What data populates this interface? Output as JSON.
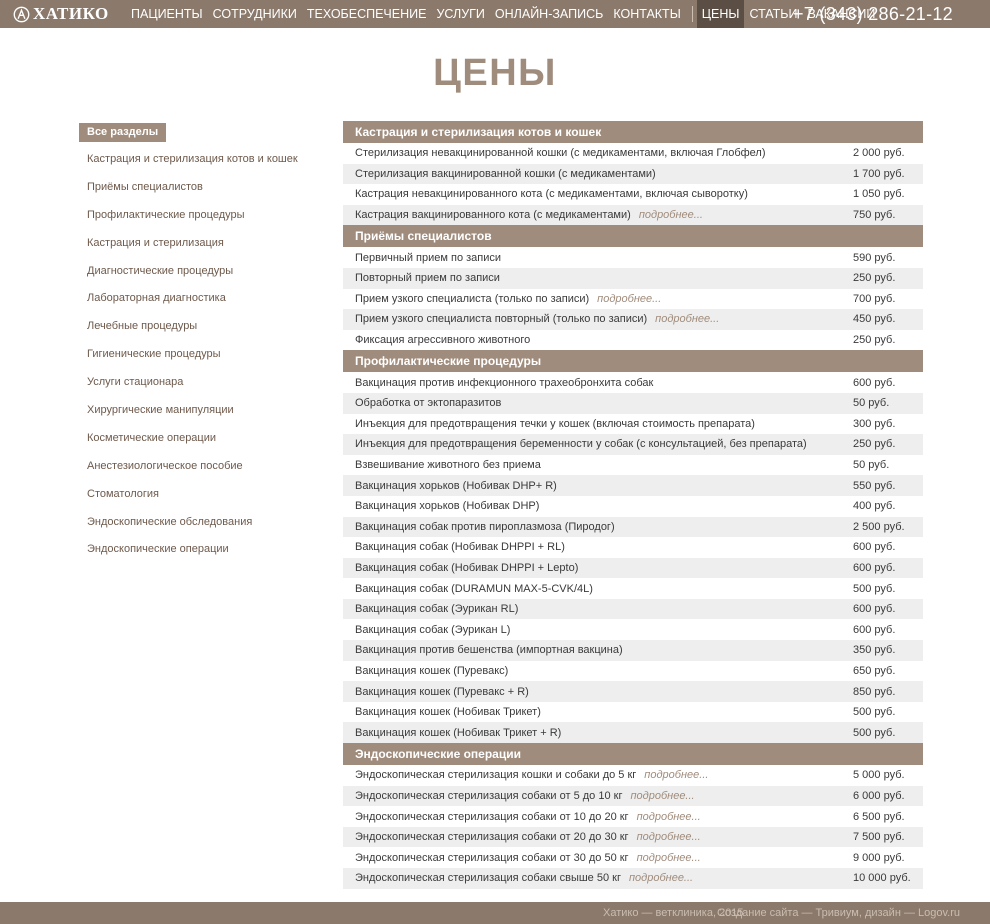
{
  "header": {
    "logo_text": "ХАТИКО",
    "nav": [
      {
        "label": "Пациенты"
      },
      {
        "label": "Сотрудники"
      },
      {
        "label": "Техобеспечение"
      },
      {
        "label": "Услуги"
      },
      {
        "label": "Онлайн-запись"
      },
      {
        "label": "Контакты"
      },
      {
        "label": "Цены",
        "active": true
      },
      {
        "label": "Статьи"
      },
      {
        "label": "Вакансии"
      }
    ],
    "phone": "+7 (343) 286-21-12"
  },
  "page_title": "ЦЕНЫ",
  "sidebar": {
    "all_label": "Все разделы",
    "items": [
      "Кастрация и стерилизация котов и кошек",
      "Приёмы специалистов",
      "Профилактические процедуры",
      "Кастрация и стерилизация",
      "Диагностические процедуры",
      "Лабораторная диагностика",
      "Лечебные процедуры",
      "Гигиенические процедуры",
      "Услуги стационара",
      "Хирургические манипуляции",
      "Косметические операции",
      "Анестезиологическое пособие",
      "Стоматология",
      "Эндоскопические обследования",
      "Эндоскопические операции"
    ]
  },
  "more_label": "подробнее...",
  "sections": [
    {
      "title": "Кастрация и стерилизация котов и кошек",
      "rows": [
        {
          "name": "Стерилизация невакцинированной кошки (с медикаментами, включая Глобфел)",
          "price": "2 000 руб."
        },
        {
          "name": "Стерилизация вакцинированной кошки (с медикаментами)",
          "price": "1 700 руб."
        },
        {
          "name": "Кастрация невакцинированного кота (с медикаментами, включая сыворотку)",
          "price": "1 050 руб."
        },
        {
          "name": "Кастрация вакцинированного кота (с медикаментами)",
          "price": "750 руб.",
          "more": true
        }
      ]
    },
    {
      "title": "Приёмы специалистов",
      "rows": [
        {
          "name": "Первичный прием по записи",
          "price": "590 руб."
        },
        {
          "name": "Повторный прием по записи",
          "price": "250 руб."
        },
        {
          "name": "Прием узкого специалиста (только по записи)",
          "price": "700 руб.",
          "more": true
        },
        {
          "name": "Прием узкого специалиста повторный (только по записи)",
          "price": "450 руб.",
          "more": true
        },
        {
          "name": "Фиксация агрессивного животного",
          "price": "250 руб."
        }
      ]
    },
    {
      "title": "Профилактические процедуры",
      "rows": [
        {
          "name": "Вакцинация против инфекционного трахеобронхита собак",
          "price": "600 руб."
        },
        {
          "name": "Обработка от эктопаразитов",
          "price": "50 руб."
        },
        {
          "name": "Инъекция для предотвращения течки у кошек (включая стоимость препарата)",
          "price": "300 руб."
        },
        {
          "name": "Инъекция для предотвращения беременности у собак (с консультацией, без препарата)",
          "price": "250 руб."
        },
        {
          "name": "Взвешивание животного без приема",
          "price": "50 руб."
        },
        {
          "name": "Вакцинация хорьков (Нобивак DHP+ R)",
          "price": "550 руб."
        },
        {
          "name": "Вакцинация хорьков (Нобивак DHP)",
          "price": "400 руб."
        },
        {
          "name": "Вакцинация собак против пироплазмоза (Пиродог)",
          "price": "2 500 руб."
        },
        {
          "name": "Вакцинация собак (Нобивак DHPPI + RL)",
          "price": "600 руб."
        },
        {
          "name": "Вакцинация собак (Нобивак DHPPI + Lepto)",
          "price": "600 руб."
        },
        {
          "name": "Вакцинация собак (DURAMUN MAX-5-CVK/4L)",
          "price": "500 руб."
        },
        {
          "name": "Вакцинация собак (Эурикан RL)",
          "price": "600 руб."
        },
        {
          "name": "Вакцинация собак (Эурикан L)",
          "price": "600 руб."
        },
        {
          "name": "Вакцинация против бешенства (импортная вакцина)",
          "price": "350 руб."
        },
        {
          "name": "Вакцинация кошек (Пуревакс)",
          "price": "650 руб."
        },
        {
          "name": "Вакцинация кошек (Пуревакс + R)",
          "price": "850 руб."
        },
        {
          "name": "Вакцинация кошек (Нобивак Трикет)",
          "price": "500 руб."
        },
        {
          "name": "Вакцинация кошек (Нобивак Трикет + R)",
          "price": "500 руб."
        }
      ]
    },
    {
      "title": "Эндоскопические операции",
      "rows": [
        {
          "name": "Эндоскопическая стерилизация кошки и собаки до 5 кг",
          "price": "5 000 руб.",
          "more": true
        },
        {
          "name": "Эндоскопическая стерилизация собаки от 5 до 10 кг",
          "price": "6 000 руб.",
          "more": true
        },
        {
          "name": "Эндоскопическая стерилизация собаки от 10 до 20 кг",
          "price": "6 500 руб.",
          "more": true
        },
        {
          "name": "Эндоскопическая стерилизация собаки от 20 до 30 кг",
          "price": "7 500 руб.",
          "more": true
        },
        {
          "name": "Эндоскопическая стерилизация собаки от 30 до 50 кг",
          "price": "9 000 руб.",
          "more": true
        },
        {
          "name": "Эндоскопическая стерилизация собаки свыше 50 кг",
          "price": "10 000 руб.",
          "more": true
        }
      ]
    }
  ],
  "footer": {
    "copyright": "Хатико — ветклиника, 2015",
    "credit": "Создание сайта — Тривиум, дизайн — Logov.ru"
  },
  "colors": {
    "header_bg": "#8b7a6c",
    "accent": "#a08c7c",
    "active_nav": "#5b4f45"
  }
}
